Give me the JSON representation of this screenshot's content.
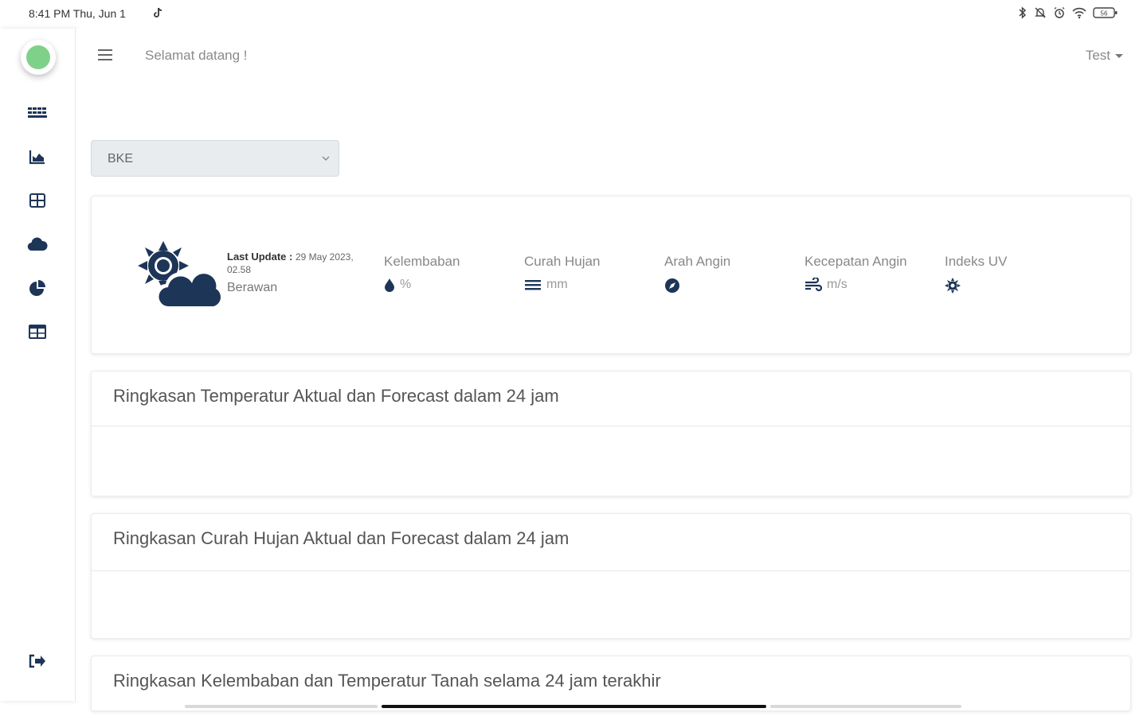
{
  "status_bar": {
    "time": "8:41 PM Thu, Jun 1",
    "battery": "56"
  },
  "topbar": {
    "welcome": "Selamat datang !",
    "user": "Test"
  },
  "station": {
    "selected": "BKE"
  },
  "weather": {
    "last_update_label": "Last Update :",
    "last_update_value": "29 May 2023, 02.58",
    "condition": "Berawan",
    "metrics": [
      {
        "label": "Kelembaban",
        "icon": "droplet-icon",
        "unit": "%"
      },
      {
        "label": "Curah Hujan",
        "icon": "rain-lines-icon",
        "unit": "mm"
      },
      {
        "label": "Arah Angin",
        "icon": "compass-icon",
        "unit": ""
      },
      {
        "label": "Kecepatan Angin",
        "icon": "wind-icon",
        "unit": "m/s"
      },
      {
        "label": "Indeks UV",
        "icon": "sun-uv-icon",
        "unit": ""
      }
    ]
  },
  "summaries": [
    "Ringkasan Temperatur Aktual dan Forecast dalam 24 jam",
    "Ringkasan Curah Hujan Aktual dan Forecast dalam 24 jam",
    "Ringkasan Kelembaban dan Temperatur Tanah selama 24 jam terakhir"
  ],
  "sidebar": {
    "items": [
      {
        "icon": "grid-dots-icon"
      },
      {
        "icon": "area-chart-icon"
      },
      {
        "icon": "table-grid-icon"
      },
      {
        "icon": "cloud-icon"
      },
      {
        "icon": "pie-chart-icon"
      },
      {
        "icon": "table-icon"
      }
    ],
    "logout_icon": "logout-icon"
  },
  "colors": {
    "navy": "#1d3557",
    "avatar": "#7fd189"
  }
}
